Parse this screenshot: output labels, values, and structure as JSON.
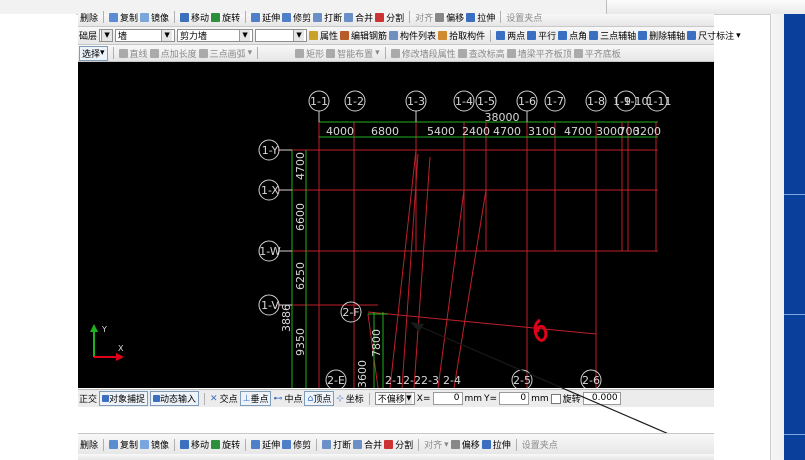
{
  "toolbar1": {
    "delete": "删除",
    "copy": "复制",
    "mirror": "镜像",
    "move": "移动",
    "rotate": "旋转",
    "extend": "延伸",
    "trim": "修剪",
    "break": "打断",
    "merge": "合并",
    "split": "分割",
    "align": "对齐",
    "offset": "偏移",
    "stretch": "拉伸",
    "set_grip": "设置夹点"
  },
  "toolbar2": {
    "layer_label": "础层",
    "type_value": "墙",
    "subtype_value": "剪力墙",
    "empty_value": "",
    "properties": "属性",
    "edit_rebar": "编辑钢筋",
    "component_list": "构件列表",
    "pick_component": "拾取构件",
    "two_points": "两点",
    "parallel": "平行",
    "point_angle": "点角",
    "three_point_axis": "三点辅轴",
    "delete_axis": "删除辅轴",
    "dimension": "尺寸标注"
  },
  "toolbar3": {
    "select": "选择",
    "line": "直线",
    "point_length": "点加长度",
    "three_point_arc": "三点画弧",
    "rectangle": "矩形",
    "smart_layout": "智能布置",
    "edit_wall_segment": "修改墙段属性",
    "view_elevation": "查改标高",
    "wall_flush_floor": "墙梁平齐板顶",
    "flush_bottom": "平齐底板"
  },
  "canvas": {
    "top_axes": [
      "1-1",
      "1-2",
      "1-3",
      "1-4",
      "1-5",
      "1-6",
      "1-7",
      "1-8",
      "1-9",
      "1-10",
      "1-11"
    ],
    "total_dimension": "38000",
    "dimensions": [
      "4000",
      "6800",
      "5400",
      "2400",
      "4700",
      "3100",
      "4700",
      "3000",
      "700",
      "3200"
    ],
    "left_axes": [
      "1-Y",
      "1-X",
      "1-W",
      "1-V"
    ],
    "left_dimensions": [
      "4700",
      "6600",
      "6250",
      "3886",
      "9350"
    ],
    "inner_labels": [
      "2-F",
      "7800",
      "3600"
    ],
    "bottom_axes": [
      "2-E",
      "2-1",
      "2-2",
      "2-3",
      "2-4",
      "2-5",
      "2-6"
    ],
    "ucs": {
      "x": "X",
      "y": "Y"
    }
  },
  "status": {
    "ortho": "正交",
    "snap": "对象捕捉",
    "dynamic_input": "动态输入",
    "intersection": "交点",
    "endpoint": "垂点",
    "midpoint": "中点",
    "vertex": "顶点",
    "coordinate": "坐标",
    "no_offset": "不偏移",
    "x_label": "X=",
    "x_value": "0",
    "mm1": "mm",
    "y_label": "Y=",
    "y_value": "0",
    "mm2": "mm",
    "rotate": "旋转",
    "angle_value": "0.000"
  },
  "toolbar4": {
    "delete": "删除",
    "copy": "复制",
    "mirror": "镜像",
    "move": "移动",
    "rotate": "旋转",
    "extend": "延伸",
    "trim": "修剪",
    "break": "打断",
    "merge": "合并",
    "split": "分割",
    "align": "对齐",
    "offset": "偏移",
    "stretch": "拉伸",
    "set_grip": "设置夹点"
  },
  "colors": {
    "cad_bg": "#000000",
    "grid_red": "#c0202a",
    "axis_green": "#1fb11f",
    "annot_red": "#e0001a"
  }
}
